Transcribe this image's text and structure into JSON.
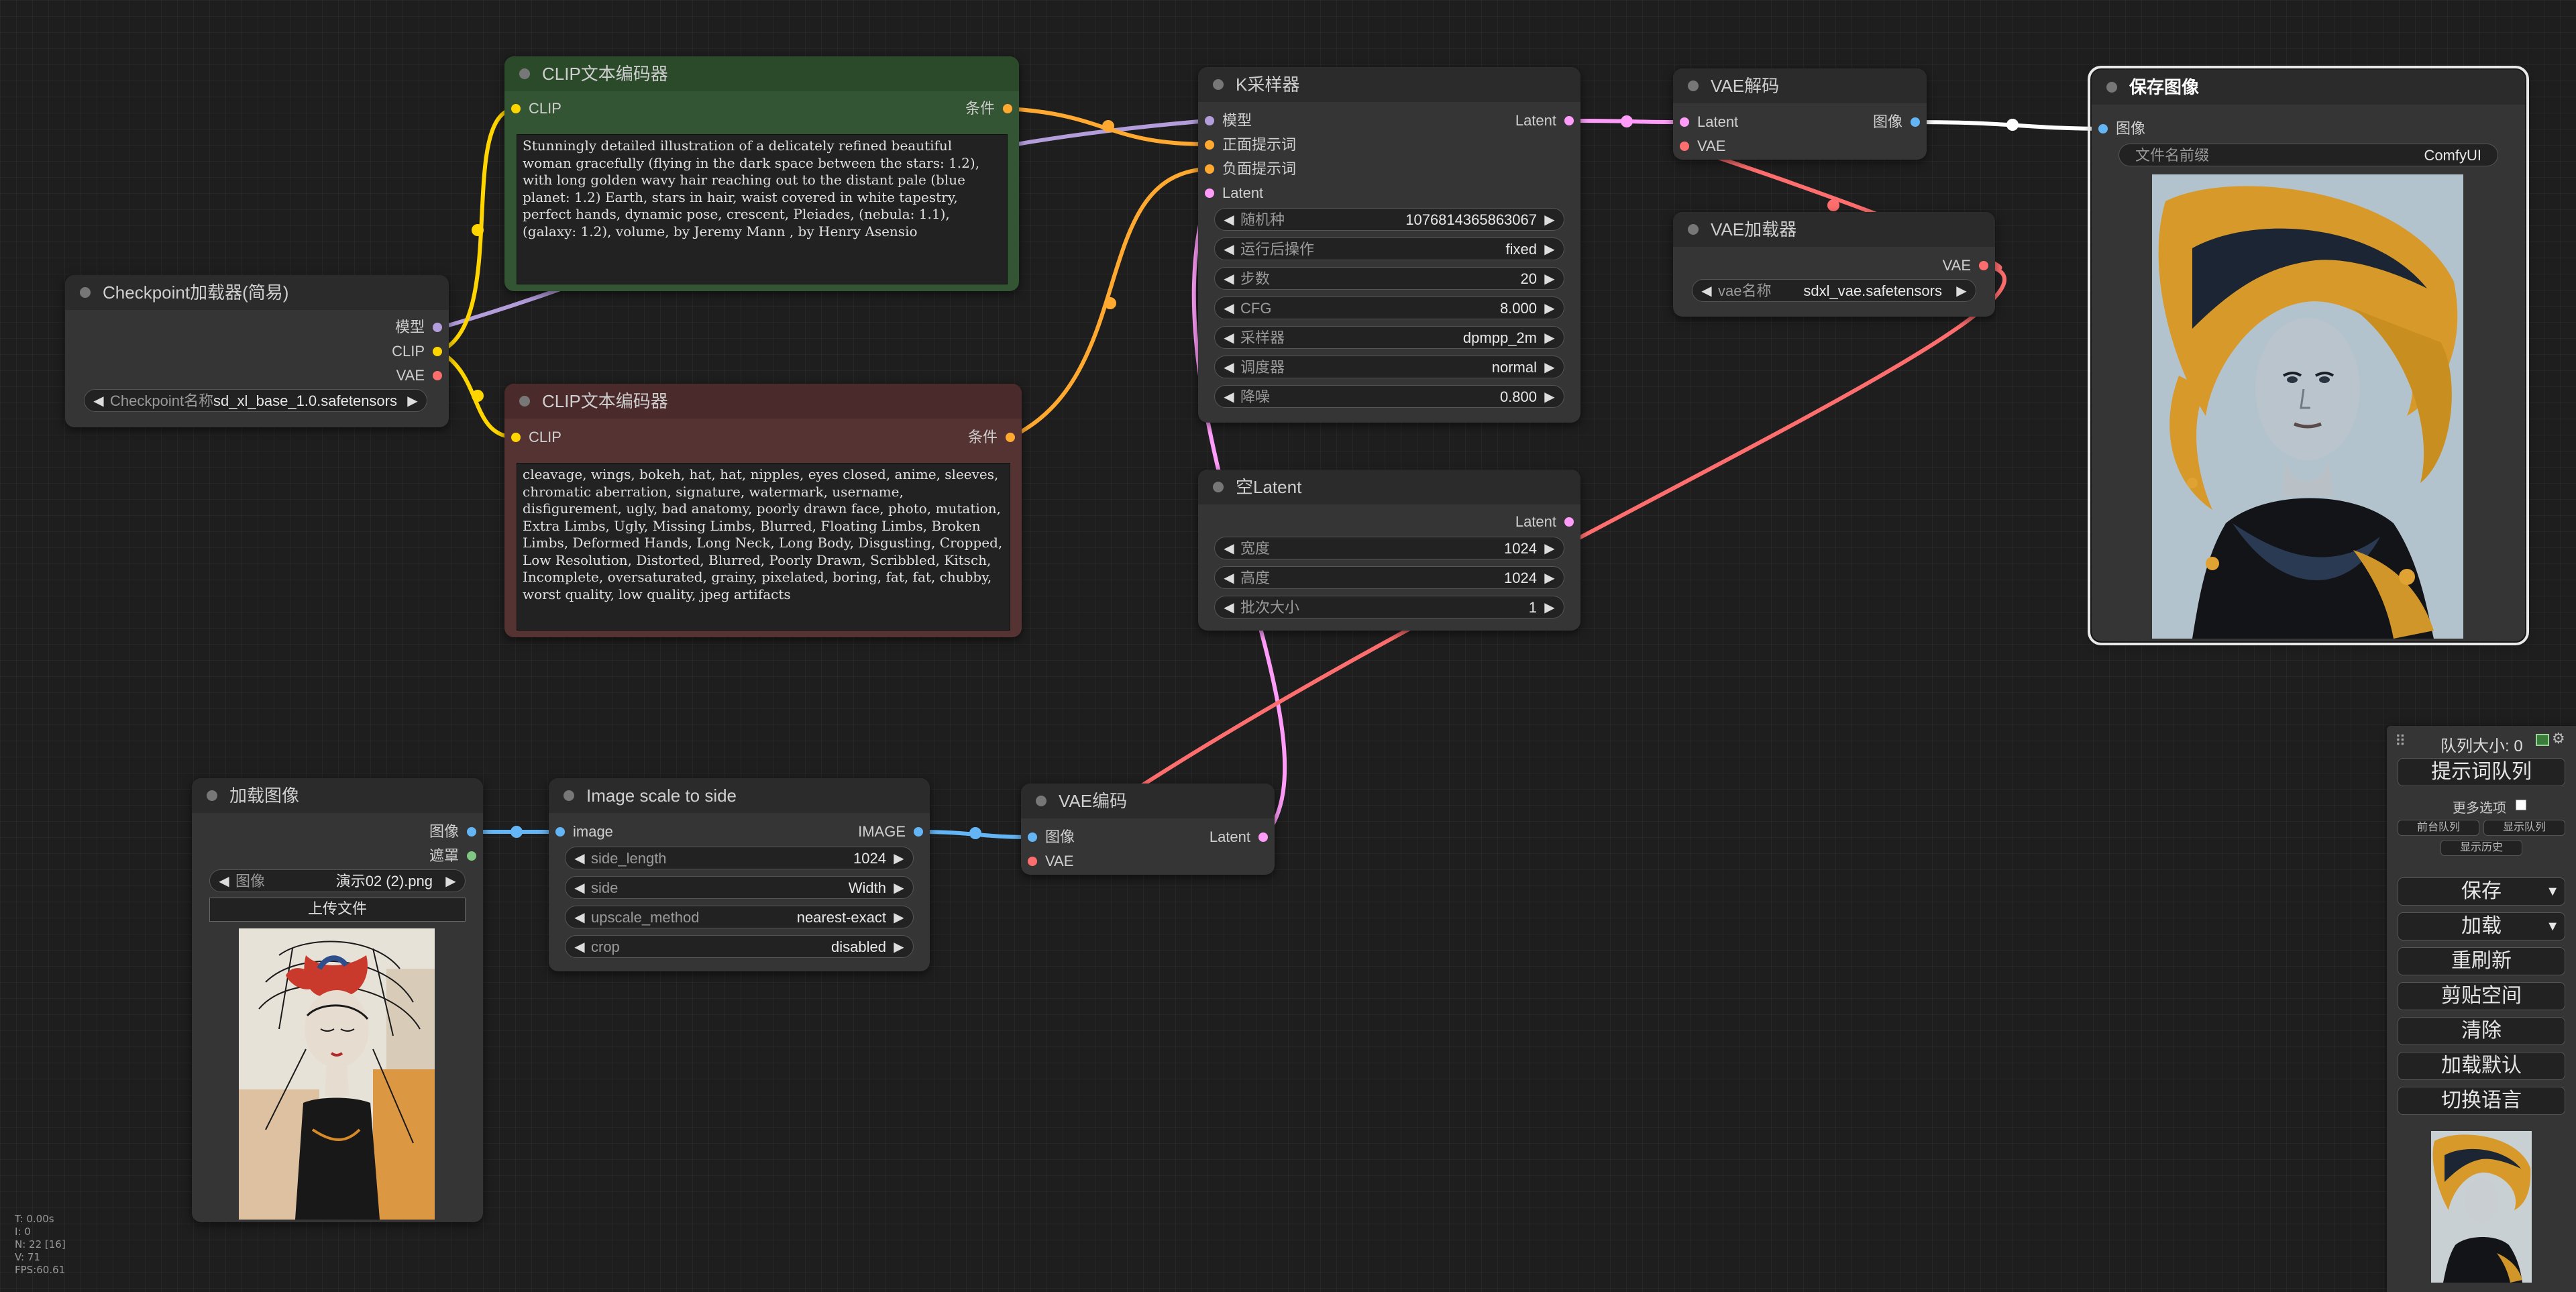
{
  "colors": {
    "clip": "#ffd500",
    "conditioning": "#ffa931",
    "model": "#b39ddb",
    "vae": "#ff6e6e",
    "latent": "#ff9cf9",
    "image": "#64b5f6",
    "mask": "#81c784",
    "green_node": "#335533",
    "red_node": "#553333",
    "node_bg": "#353535",
    "canvas": "#1e1e1e"
  },
  "nodes": {
    "checkpoint": {
      "title": "Checkpoint加载器(简易)",
      "outputs": [
        "模型",
        "CLIP",
        "VAE"
      ],
      "widget_label": "Checkpoint名称",
      "widget_value": "sd_xl_base_1.0.safetensors"
    },
    "clip_pos": {
      "title": "CLIP文本编码器",
      "input": "CLIP",
      "output": "条件",
      "text": "Stunningly detailed illustration of a delicately refined beautiful woman gracefully (flying in the dark space between the stars: 1.2), with long golden wavy hair reaching out to the distant pale (blue planet: 1.2) Earth, stars in hair, waist covered in white tapestry, perfect hands, dynamic pose, crescent, Pleiades, (nebula: 1.1), (galaxy: 1.2), volume, by Jeremy Mann , by Henry Asensio"
    },
    "clip_neg": {
      "title": "CLIP文本编码器",
      "input": "CLIP",
      "output": "条件",
      "text": "cleavage, wings, bokeh, hat, hat, nipples, eyes closed, anime, sleeves, chromatic aberration, signature, watermark, username, disfigurement, ugly, bad anatomy, poorly drawn face, photo, mutation, Extra Limbs, Ugly, Missing Limbs, Blurred, Floating Limbs, Broken Limbs, Deformed Hands, Long Neck, Long Body, Disgusting, Cropped, Low Resolution, Distorted, Blurred, Poorly Drawn, Scribbled, Kitsch, Incomplete, oversaturated, grainy, pixelated, boring, fat, fat, chubby, worst quality, low quality, jpeg artifacts"
    },
    "ksampler": {
      "title": "K采样器",
      "inputs": [
        "模型",
        "正面提示词",
        "负面提示词",
        "Latent"
      ],
      "output": "Latent",
      "widgets": [
        {
          "label": "随机种",
          "value": "1076814365863067"
        },
        {
          "label": "运行后操作",
          "value": "fixed"
        },
        {
          "label": "步数",
          "value": "20"
        },
        {
          "label": "CFG",
          "value": "8.000"
        },
        {
          "label": "采样器",
          "value": "dpmpp_2m"
        },
        {
          "label": "调度器",
          "value": "normal"
        },
        {
          "label": "降噪",
          "value": "0.800"
        }
      ]
    },
    "vae_decode": {
      "title": "VAE解码",
      "inputs": [
        "Latent",
        "VAE"
      ],
      "output": "图像"
    },
    "vae_loader": {
      "title": "VAE加载器",
      "output": "VAE",
      "widget_label": "vae名称",
      "widget_value": "sdxl_vae.safetensors"
    },
    "save_image": {
      "title": "保存图像",
      "input": "图像",
      "widget_label": "文件名前缀",
      "widget_value": "ComfyUI"
    },
    "empty_latent": {
      "title": "空Latent",
      "output": "Latent",
      "widgets": [
        {
          "label": "宽度",
          "value": "1024"
        },
        {
          "label": "高度",
          "value": "1024"
        },
        {
          "label": "批次大小",
          "value": "1"
        }
      ]
    },
    "load_image": {
      "title": "加载图像",
      "outputs": [
        "图像",
        "遮罩"
      ],
      "widget_label": "图像",
      "widget_value": "演示02 (2).png",
      "upload_label": "上传文件"
    },
    "image_scale": {
      "title": "Image scale to side",
      "input": "image",
      "output": "IMAGE",
      "widgets": [
        {
          "label": "side_length",
          "value": "1024"
        },
        {
          "label": "side",
          "value": "Width"
        },
        {
          "label": "upscale_method",
          "value": "nearest-exact"
        },
        {
          "label": "crop",
          "value": "disabled"
        }
      ]
    },
    "vae_encode": {
      "title": "VAE编码",
      "inputs": [
        "图像",
        "VAE"
      ],
      "output": "Latent"
    }
  },
  "menu": {
    "queue_size": "队列大小: 0",
    "queue_prompt": "提示词队列",
    "extra_options": "更多选项",
    "queue_front": "前台队列",
    "view_queue": "显示队列",
    "view_history": "显示历史",
    "save": "保存",
    "load": "加载",
    "refresh": "重刷新",
    "clipspace": "剪贴空间",
    "clear": "清除",
    "load_default": "加载默认",
    "switch_locale": "切换语言",
    "icons": [
      "drag-handle-icon",
      "image-icon",
      "gear-icon",
      "chevron-down-icon"
    ]
  },
  "stats": {
    "t": "T: 0.00s",
    "i": "I: 0",
    "n": "N: 22 [16]",
    "v": "V: 71",
    "fps": "FPS:60.61"
  }
}
